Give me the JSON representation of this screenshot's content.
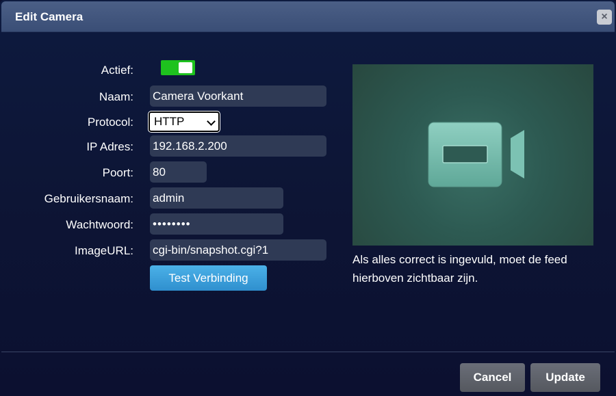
{
  "dialog": {
    "title": "Edit Camera",
    "close_icon": "×"
  },
  "form": {
    "active": {
      "label": "Actief:",
      "on": true
    },
    "name": {
      "label": "Naam:",
      "value": "Camera Voorkant"
    },
    "protocol": {
      "label": "Protocol:",
      "value": "HTTP"
    },
    "ip": {
      "label": "IP Adres:",
      "value": "192.168.2.200"
    },
    "port": {
      "label": "Poort:",
      "value": "80"
    },
    "username": {
      "label": "Gebruikersnaam:",
      "value": "admin"
    },
    "password": {
      "label": "Wachtwoord:",
      "value": "••••••••"
    },
    "image_url": {
      "label": "ImageURL:",
      "value": "cgi-bin/snapshot.cgi?1"
    },
    "test_button": "Test Verbinding"
  },
  "preview": {
    "icon": "video-camera-icon",
    "help_text": "Als alles correct is ingevuld, moet de feed hierboven zichtbaar zijn."
  },
  "footer": {
    "cancel_label": "Cancel",
    "update_label": "Update"
  },
  "colors": {
    "toggle_on": "#1ec21e",
    "accent_button": "#3a9fdb",
    "preview_bg": "#2d5a52"
  }
}
